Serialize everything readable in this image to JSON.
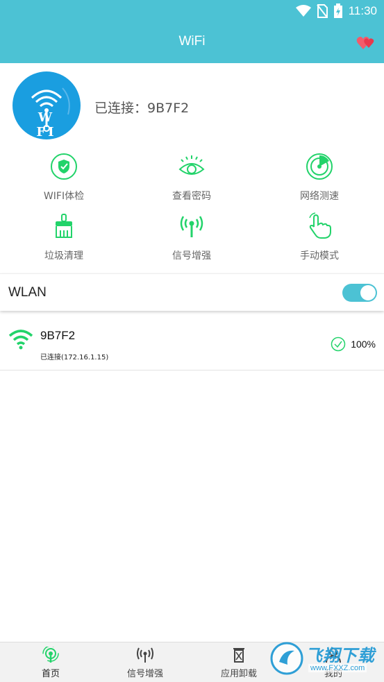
{
  "status_bar": {
    "time": "11:30"
  },
  "title_bar": {
    "title": "WiFi"
  },
  "header": {
    "logo_text": "W FI",
    "connected_text": "已连接：9B7F2"
  },
  "features": [
    {
      "label": "WIFI体检"
    },
    {
      "label": "查看密码"
    },
    {
      "label": "网络测速"
    },
    {
      "label": "垃圾清理"
    },
    {
      "label": "信号增强"
    },
    {
      "label": "手动模式"
    }
  ],
  "wlan": {
    "label": "WLAN",
    "enabled": true
  },
  "networks": [
    {
      "name": "9B7F2",
      "status": "已连接(172.16.1.15)",
      "signal": "100%"
    }
  ],
  "bottom_nav": [
    {
      "label": "首页",
      "active": true
    },
    {
      "label": "信号增强",
      "active": false
    },
    {
      "label": "应用卸载",
      "active": false
    },
    {
      "label": "我的",
      "active": false
    }
  ],
  "watermark": {
    "text": "飞翔下载",
    "url_text": "www.FXXZ.com"
  },
  "colors": {
    "primary": "#4cc2d4",
    "accent_green": "#22d36a",
    "logo_blue": "#1a9ee0"
  }
}
